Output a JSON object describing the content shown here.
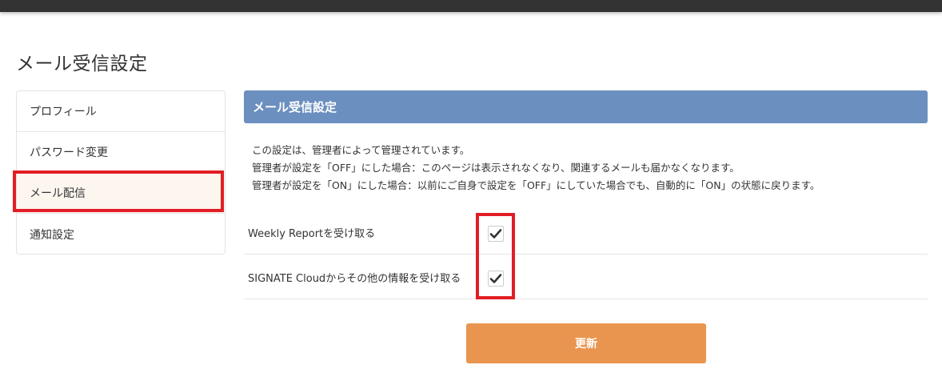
{
  "page": {
    "title": "メール受信設定"
  },
  "sidebar": {
    "items": [
      {
        "label": "プロフィール"
      },
      {
        "label": "パスワード変更"
      },
      {
        "label": "メール配信"
      },
      {
        "label": "通知設定"
      }
    ]
  },
  "panel": {
    "header": "メール受信設定",
    "description": [
      "この設定は、管理者によって管理されています。",
      "管理者が設定を「OFF」にした場合：このページは表示されなくなり、関連するメールも届かなくなります。",
      "管理者が設定を「ON」にした場合：以前にご自身で設定を「OFF」にしていた場合でも、自動的に「ON」の状態に戻ります。"
    ],
    "settings": [
      {
        "label": "Weekly Reportを受け取る",
        "checked": true,
        "icon": "checkmark-icon"
      },
      {
        "label": "SIGNATE Cloudからその他の情報を受け取る",
        "checked": true,
        "icon": "checkmark-icon"
      }
    ],
    "update_label": "更新"
  },
  "colors": {
    "topbar": "#333333",
    "header_bg": "#6b8fbf",
    "highlight": "#e21d25",
    "button": "#e9954f",
    "active_bg": "#fdf6ef"
  }
}
